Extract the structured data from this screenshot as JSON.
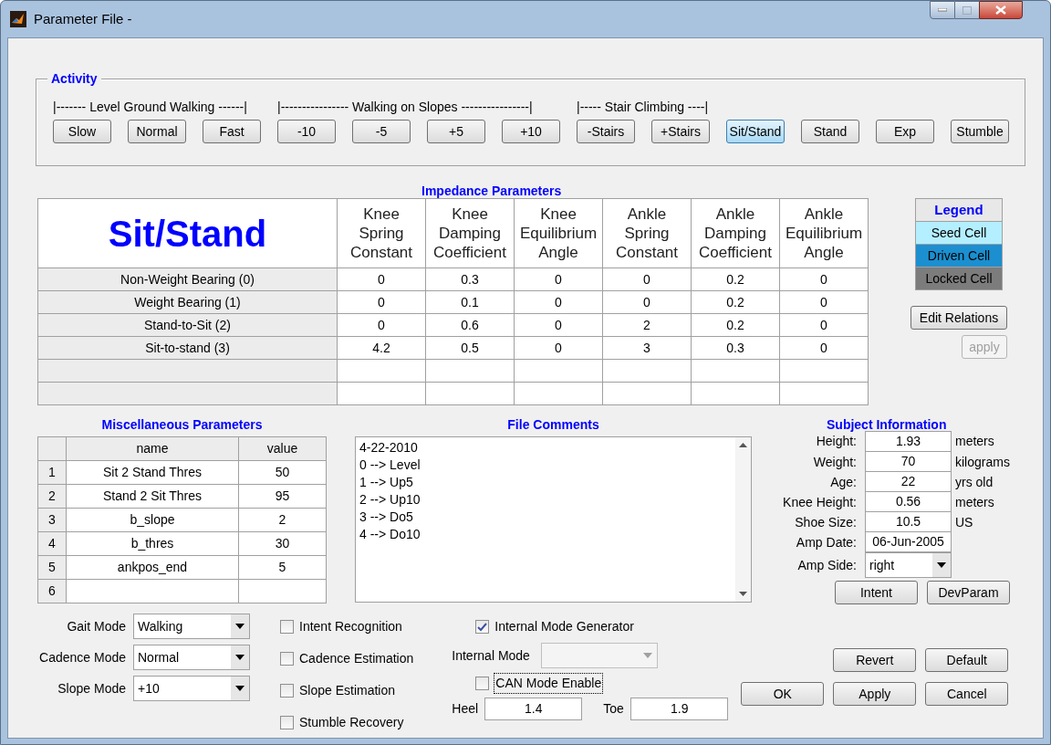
{
  "window": {
    "title": "Parameter File -"
  },
  "activity": {
    "title": "Activity",
    "groups": [
      {
        "label": "|------- Level Ground Walking ------|",
        "buttons": [
          {
            "label": "Slow",
            "selected": false
          },
          {
            "label": "Normal",
            "selected": false
          },
          {
            "label": "Fast",
            "selected": false
          }
        ]
      },
      {
        "label": "|---------------- Walking on Slopes ----------------|",
        "buttons": [
          {
            "label": "-10",
            "selected": false
          },
          {
            "label": "-5",
            "selected": false
          },
          {
            "label": "+5",
            "selected": false
          },
          {
            "label": "+10",
            "selected": false
          }
        ]
      },
      {
        "label": "|----- Stair Climbing ----|",
        "buttons": [
          {
            "label": "-Stairs",
            "selected": false
          },
          {
            "label": "+Stairs",
            "selected": false
          }
        ]
      },
      {
        "buttons": [
          {
            "label": "Sit/Stand",
            "selected": true
          },
          {
            "label": "Stand",
            "selected": false
          },
          {
            "label": "Exp",
            "selected": false
          },
          {
            "label": "Stumble",
            "selected": false
          }
        ]
      }
    ]
  },
  "impedance": {
    "title": "Impedance Parameters",
    "activity_name": "Sit/Stand",
    "columns": [
      {
        "lines": [
          "Knee",
          "Spring",
          "Constant"
        ]
      },
      {
        "lines": [
          "Knee",
          "Damping",
          "Coefficient"
        ]
      },
      {
        "lines": [
          "Knee",
          "Equilibrium",
          "Angle"
        ]
      },
      {
        "lines": [
          "Ankle",
          "Spring",
          "Constant"
        ]
      },
      {
        "lines": [
          "Ankle",
          "Damping",
          "Coefficient"
        ]
      },
      {
        "lines": [
          "Ankle",
          "Equilibrium",
          "Angle"
        ]
      }
    ],
    "rows": [
      {
        "label": "Non-Weight Bearing (0)",
        "values": [
          "0",
          "0.3",
          "0",
          "0",
          "0.2",
          "0"
        ]
      },
      {
        "label": "Weight Bearing (1)",
        "values": [
          "0",
          "0.1",
          "0",
          "0",
          "0.2",
          "0"
        ]
      },
      {
        "label": "Stand-to-Sit (2)",
        "values": [
          "0",
          "0.6",
          "0",
          "2",
          "0.2",
          "0"
        ]
      },
      {
        "label": "Sit-to-stand (3)",
        "values": [
          "4.2",
          "0.5",
          "0",
          "3",
          "0.3",
          "0"
        ]
      }
    ]
  },
  "legend": {
    "title": "Legend",
    "items": [
      {
        "label": "Seed Cell",
        "color": "#b4efff"
      },
      {
        "label": "Driven Cell",
        "color": "#1b8fd0"
      },
      {
        "label": "Locked Cell",
        "color": "#7c7c7c"
      }
    ]
  },
  "edit_relations": {
    "label": "Edit Relations",
    "disabled": false
  },
  "apply_relations": {
    "label": "apply",
    "disabled": true
  },
  "misc": {
    "title": "Miscellaneous Parameters",
    "columns": [
      "name",
      "value"
    ],
    "rows": [
      {
        "index": "1",
        "name": "Sit 2 Stand Thres",
        "value": "50"
      },
      {
        "index": "2",
        "name": "Stand 2 Sit Thres",
        "value": "95"
      },
      {
        "index": "3",
        "name": "b_slope",
        "value": "2"
      },
      {
        "index": "4",
        "name": "b_thres",
        "value": "30"
      },
      {
        "index": "5",
        "name": "ankpos_end",
        "value": "5"
      },
      {
        "index": "6"
      }
    ]
  },
  "comments": {
    "title": "File Comments",
    "lines": [
      "4-22-2010",
      "0 --> Level",
      "1 --> Up5",
      "2 --> Up10",
      "3 --> Do5",
      "4 --> Do10"
    ]
  },
  "subject": {
    "title": "Subject Information",
    "fields": [
      {
        "kind": "text",
        "label": "Height:",
        "value": "1.93",
        "unit": "meters"
      },
      {
        "kind": "text",
        "label": "Weight:",
        "value": "70",
        "unit": "kilograms"
      },
      {
        "kind": "text",
        "label": "Age:",
        "value": "22",
        "unit": "yrs old"
      },
      {
        "kind": "text",
        "label": "Knee Height:",
        "value": "0.56",
        "unit": "meters"
      },
      {
        "kind": "text",
        "label": "Shoe Size:",
        "value": "10.5",
        "unit": "US"
      },
      {
        "kind": "text",
        "label": "Amp Date:",
        "value": "06-Jun-2005"
      },
      {
        "kind": "dropdown",
        "label": "Amp Side:",
        "value": "right"
      }
    ],
    "buttons": [
      "Intent",
      "DevParam"
    ]
  },
  "modes": [
    {
      "label": "Gait Mode",
      "value": "Walking"
    },
    {
      "label": "Cadence Mode",
      "value": "Normal"
    },
    {
      "label": "Slope Mode",
      "value": "+10"
    }
  ],
  "options": [
    {
      "label": "Intent Recognition",
      "checked": false
    },
    {
      "label": "Cadence Estimation",
      "checked": false
    },
    {
      "label": "Slope Estimation",
      "checked": false
    },
    {
      "label": "Stumble Recovery",
      "checked": false
    }
  ],
  "internal_mode_generator": {
    "label": "Internal Mode Generator",
    "checked": true
  },
  "internal_mode": {
    "label": "Internal Mode",
    "disabled": true
  },
  "can_mode": {
    "label": "CAN Mode Enable",
    "checked": false,
    "focused": true
  },
  "heel": {
    "label": "Heel",
    "value": "1.4"
  },
  "toe": {
    "label": "Toe",
    "value": "1.9"
  },
  "dialog_buttons": {
    "top": [
      "Revert",
      "Default"
    ],
    "bottom": [
      "OK",
      "Apply",
      "Cancel"
    ]
  }
}
